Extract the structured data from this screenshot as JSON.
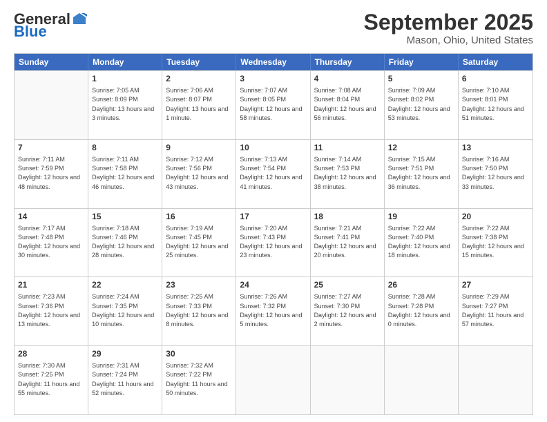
{
  "header": {
    "logo_general": "General",
    "logo_blue": "Blue",
    "month": "September 2025",
    "location": "Mason, Ohio, United States"
  },
  "weekdays": [
    "Sunday",
    "Monday",
    "Tuesday",
    "Wednesday",
    "Thursday",
    "Friday",
    "Saturday"
  ],
  "weeks": [
    [
      {
        "day": "",
        "empty": true
      },
      {
        "day": "1",
        "sunrise": "Sunrise: 7:05 AM",
        "sunset": "Sunset: 8:09 PM",
        "daylight": "Daylight: 13 hours and 3 minutes."
      },
      {
        "day": "2",
        "sunrise": "Sunrise: 7:06 AM",
        "sunset": "Sunset: 8:07 PM",
        "daylight": "Daylight: 13 hours and 1 minute."
      },
      {
        "day": "3",
        "sunrise": "Sunrise: 7:07 AM",
        "sunset": "Sunset: 8:05 PM",
        "daylight": "Daylight: 12 hours and 58 minutes."
      },
      {
        "day": "4",
        "sunrise": "Sunrise: 7:08 AM",
        "sunset": "Sunset: 8:04 PM",
        "daylight": "Daylight: 12 hours and 56 minutes."
      },
      {
        "day": "5",
        "sunrise": "Sunrise: 7:09 AM",
        "sunset": "Sunset: 8:02 PM",
        "daylight": "Daylight: 12 hours and 53 minutes."
      },
      {
        "day": "6",
        "sunrise": "Sunrise: 7:10 AM",
        "sunset": "Sunset: 8:01 PM",
        "daylight": "Daylight: 12 hours and 51 minutes."
      }
    ],
    [
      {
        "day": "7",
        "sunrise": "Sunrise: 7:11 AM",
        "sunset": "Sunset: 7:59 PM",
        "daylight": "Daylight: 12 hours and 48 minutes."
      },
      {
        "day": "8",
        "sunrise": "Sunrise: 7:11 AM",
        "sunset": "Sunset: 7:58 PM",
        "daylight": "Daylight: 12 hours and 46 minutes."
      },
      {
        "day": "9",
        "sunrise": "Sunrise: 7:12 AM",
        "sunset": "Sunset: 7:56 PM",
        "daylight": "Daylight: 12 hours and 43 minutes."
      },
      {
        "day": "10",
        "sunrise": "Sunrise: 7:13 AM",
        "sunset": "Sunset: 7:54 PM",
        "daylight": "Daylight: 12 hours and 41 minutes."
      },
      {
        "day": "11",
        "sunrise": "Sunrise: 7:14 AM",
        "sunset": "Sunset: 7:53 PM",
        "daylight": "Daylight: 12 hours and 38 minutes."
      },
      {
        "day": "12",
        "sunrise": "Sunrise: 7:15 AM",
        "sunset": "Sunset: 7:51 PM",
        "daylight": "Daylight: 12 hours and 36 minutes."
      },
      {
        "day": "13",
        "sunrise": "Sunrise: 7:16 AM",
        "sunset": "Sunset: 7:50 PM",
        "daylight": "Daylight: 12 hours and 33 minutes."
      }
    ],
    [
      {
        "day": "14",
        "sunrise": "Sunrise: 7:17 AM",
        "sunset": "Sunset: 7:48 PM",
        "daylight": "Daylight: 12 hours and 30 minutes."
      },
      {
        "day": "15",
        "sunrise": "Sunrise: 7:18 AM",
        "sunset": "Sunset: 7:46 PM",
        "daylight": "Daylight: 12 hours and 28 minutes."
      },
      {
        "day": "16",
        "sunrise": "Sunrise: 7:19 AM",
        "sunset": "Sunset: 7:45 PM",
        "daylight": "Daylight: 12 hours and 25 minutes."
      },
      {
        "day": "17",
        "sunrise": "Sunrise: 7:20 AM",
        "sunset": "Sunset: 7:43 PM",
        "daylight": "Daylight: 12 hours and 23 minutes."
      },
      {
        "day": "18",
        "sunrise": "Sunrise: 7:21 AM",
        "sunset": "Sunset: 7:41 PM",
        "daylight": "Daylight: 12 hours and 20 minutes."
      },
      {
        "day": "19",
        "sunrise": "Sunrise: 7:22 AM",
        "sunset": "Sunset: 7:40 PM",
        "daylight": "Daylight: 12 hours and 18 minutes."
      },
      {
        "day": "20",
        "sunrise": "Sunrise: 7:22 AM",
        "sunset": "Sunset: 7:38 PM",
        "daylight": "Daylight: 12 hours and 15 minutes."
      }
    ],
    [
      {
        "day": "21",
        "sunrise": "Sunrise: 7:23 AM",
        "sunset": "Sunset: 7:36 PM",
        "daylight": "Daylight: 12 hours and 13 minutes."
      },
      {
        "day": "22",
        "sunrise": "Sunrise: 7:24 AM",
        "sunset": "Sunset: 7:35 PM",
        "daylight": "Daylight: 12 hours and 10 minutes."
      },
      {
        "day": "23",
        "sunrise": "Sunrise: 7:25 AM",
        "sunset": "Sunset: 7:33 PM",
        "daylight": "Daylight: 12 hours and 8 minutes."
      },
      {
        "day": "24",
        "sunrise": "Sunrise: 7:26 AM",
        "sunset": "Sunset: 7:32 PM",
        "daylight": "Daylight: 12 hours and 5 minutes."
      },
      {
        "day": "25",
        "sunrise": "Sunrise: 7:27 AM",
        "sunset": "Sunset: 7:30 PM",
        "daylight": "Daylight: 12 hours and 2 minutes."
      },
      {
        "day": "26",
        "sunrise": "Sunrise: 7:28 AM",
        "sunset": "Sunset: 7:28 PM",
        "daylight": "Daylight: 12 hours and 0 minutes."
      },
      {
        "day": "27",
        "sunrise": "Sunrise: 7:29 AM",
        "sunset": "Sunset: 7:27 PM",
        "daylight": "Daylight: 11 hours and 57 minutes."
      }
    ],
    [
      {
        "day": "28",
        "sunrise": "Sunrise: 7:30 AM",
        "sunset": "Sunset: 7:25 PM",
        "daylight": "Daylight: 11 hours and 55 minutes."
      },
      {
        "day": "29",
        "sunrise": "Sunrise: 7:31 AM",
        "sunset": "Sunset: 7:24 PM",
        "daylight": "Daylight: 11 hours and 52 minutes."
      },
      {
        "day": "30",
        "sunrise": "Sunrise: 7:32 AM",
        "sunset": "Sunset: 7:22 PM",
        "daylight": "Daylight: 11 hours and 50 minutes."
      },
      {
        "day": "",
        "empty": true
      },
      {
        "day": "",
        "empty": true
      },
      {
        "day": "",
        "empty": true
      },
      {
        "day": "",
        "empty": true
      }
    ]
  ]
}
